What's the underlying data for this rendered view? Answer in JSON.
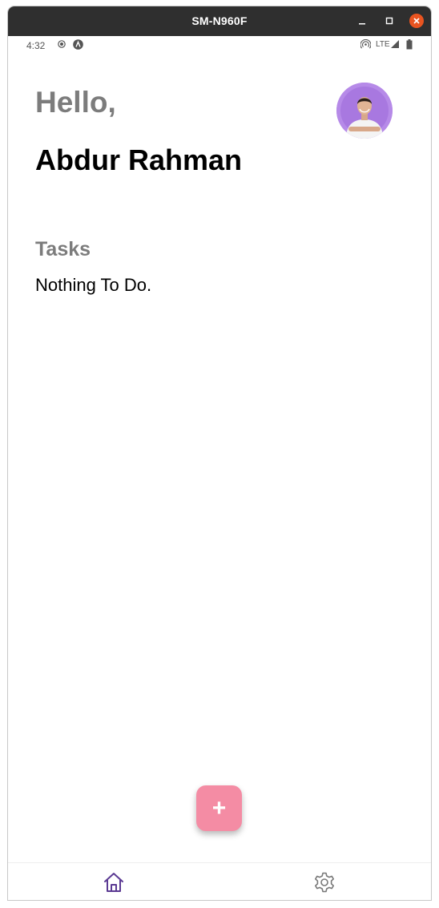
{
  "window": {
    "title": "SM-N960F"
  },
  "statusbar": {
    "time": "4:32",
    "network": "LTE",
    "icons": [
      "record-icon",
      "accessibility-icon",
      "hotspot-icon",
      "signal-icon",
      "battery-icon"
    ]
  },
  "header": {
    "greeting": "Hello,",
    "user_name": "Abdur Rahman"
  },
  "tasks": {
    "heading": "Tasks",
    "empty_message": "Nothing To Do."
  },
  "fab": {
    "label": "+"
  },
  "bottom_nav": {
    "items": [
      {
        "icon": "home-icon",
        "active": true
      },
      {
        "icon": "gear-icon",
        "active": false
      }
    ]
  },
  "colors": {
    "titlebar": "#2f2f2f",
    "close_button": "#e95420",
    "greeting_text": "#7c7c7c",
    "fab_background": "#f48ca4",
    "avatar_background": "#b68ae8",
    "nav_active": "#5b3a93",
    "nav_inactive": "#777777"
  }
}
